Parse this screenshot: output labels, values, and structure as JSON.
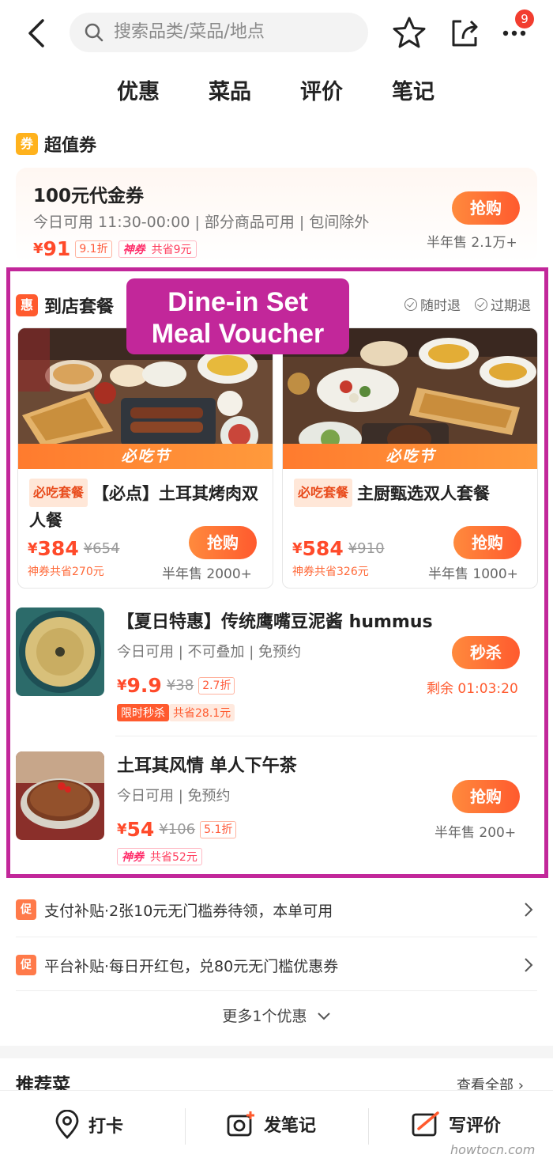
{
  "header": {
    "search_placeholder": "搜索品类/菜品/地点",
    "notification_count": "9"
  },
  "tabs": [
    {
      "label": "优惠"
    },
    {
      "label": "菜品"
    },
    {
      "label": "评价"
    },
    {
      "label": "笔记"
    }
  ],
  "coupon_section": {
    "icon_text": "券",
    "title": "超值券",
    "voucher": {
      "title": "100元代金券",
      "subtitle": "今日可用 11:30-00:00 | 部分商品可用 | 包间除外",
      "currency": "¥",
      "price": "91",
      "discount": "9.1折",
      "shen_label": "神券",
      "saving": "共省9元",
      "buy_label": "抢购",
      "sold": "半年售 2.1万+"
    }
  },
  "annotation": {
    "line1": "Dine-in Set",
    "line2": "Meal Voucher"
  },
  "set_section": {
    "icon_text": "惠",
    "title": "到店套餐",
    "guarantee1": "随时退",
    "guarantee2": "过期退",
    "band_label": "必吃节",
    "tag_label": "必吃套餐",
    "cards": [
      {
        "name": "【必点】土耳其烤肉双人餐",
        "currency": "¥",
        "price": "384",
        "original": "¥654",
        "saving": "神券共省270元",
        "buy_label": "抢购",
        "sold": "半年售 2000+"
      },
      {
        "name": "主厨甄选双人套餐",
        "currency": "¥",
        "price": "584",
        "original": "¥910",
        "saving": "神券共省326元",
        "buy_label": "抢购",
        "sold": "半年售 1000+"
      }
    ],
    "items": [
      {
        "title": "【夏日特惠】传统鹰嘴豆泥酱 hummus",
        "subtitle": "今日可用 | 不可叠加 | 免预约",
        "currency": "¥",
        "price": "9.9",
        "original": "¥38",
        "discount": "2.7折",
        "tag": "限时秒杀",
        "saving": "共省28.1元",
        "buy_label": "秒杀",
        "status": "剩余 01:03:20"
      },
      {
        "title": "土耳其风情 单人下午茶",
        "subtitle": "今日可用 | 免预约",
        "currency": "¥",
        "price": "54",
        "original": "¥106",
        "discount": "5.1折",
        "shen_label": "神券",
        "saving": "共省52元",
        "buy_label": "抢购",
        "status": "半年售 200+"
      }
    ]
  },
  "promos": [
    {
      "icon_text": "促",
      "text": "支付补贴·2张10元无门槛券待领，本单可用"
    },
    {
      "icon_text": "促",
      "text": "平台补贴·每日开红包，兑80元无门槛优惠券"
    }
  ],
  "more_offers": "更多1个优惠",
  "recommend": {
    "title": "推荐菜",
    "view_all": "查看全部"
  },
  "bottom_bar": {
    "checkin": "打卡",
    "post_note": "发笔记",
    "write_review": "写评价"
  },
  "watermark": "howtocn.com"
}
